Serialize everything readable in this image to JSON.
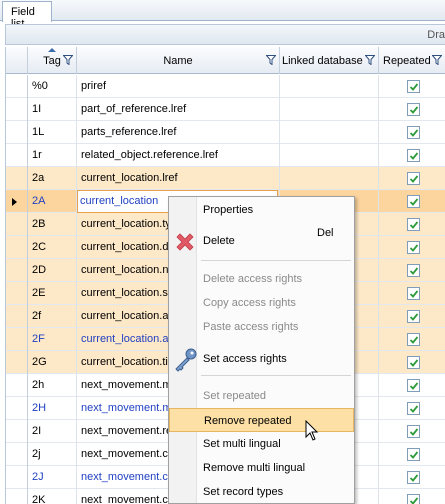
{
  "tab": {
    "label": "Field list"
  },
  "drag_area": {
    "text": "Dra"
  },
  "columns": [
    {
      "label": "Tag",
      "sorted": true,
      "filter": true
    },
    {
      "label": "Name",
      "filter": true
    },
    {
      "label": "Linked database",
      "filter": true
    },
    {
      "label": "Repeated",
      "filter": true
    }
  ],
  "rows": [
    {
      "tag": "%0",
      "name": "priref",
      "blue": false,
      "state": "normal",
      "repeated": true
    },
    {
      "tag": "1I",
      "name": "part_of_reference.lref",
      "blue": false,
      "state": "normal",
      "repeated": true
    },
    {
      "tag": "1L",
      "name": "parts_reference.lref",
      "blue": false,
      "state": "normal",
      "repeated": true
    },
    {
      "tag": "1r",
      "name": "related_object.reference.lref",
      "blue": false,
      "state": "normal",
      "repeated": true
    },
    {
      "tag": "2a",
      "name": "current_location.lref",
      "blue": false,
      "state": "alt",
      "repeated": true
    },
    {
      "tag": "2A",
      "name": "current_location",
      "blue": true,
      "state": "sel",
      "repeated": true
    },
    {
      "tag": "2B",
      "name": "current_location.ty",
      "blue": false,
      "state": "alt",
      "repeated": true
    },
    {
      "tag": "2C",
      "name": "current_location.da",
      "blue": false,
      "state": "alt",
      "repeated": true
    },
    {
      "tag": "2D",
      "name": "current_location.no",
      "blue": false,
      "state": "alt",
      "repeated": true
    },
    {
      "tag": "2E",
      "name": "current_location.su",
      "blue": false,
      "state": "alt",
      "repeated": true
    },
    {
      "tag": "2f",
      "name": "current_location.a",
      "blue": false,
      "state": "alt",
      "repeated": true
    },
    {
      "tag": "2F",
      "name": "current_location.a",
      "blue": true,
      "state": "alt",
      "repeated": true
    },
    {
      "tag": "2G",
      "name": "current_location.ti",
      "blue": false,
      "state": "alt",
      "repeated": true
    },
    {
      "tag": "2h",
      "name": "next_movement.m",
      "blue": false,
      "state": "normal",
      "repeated": true
    },
    {
      "tag": "2H",
      "name": "next_movement.m",
      "blue": true,
      "state": "normal",
      "repeated": true
    },
    {
      "tag": "2I",
      "name": "next_movement.re",
      "blue": false,
      "state": "normal",
      "repeated": true
    },
    {
      "tag": "2j",
      "name": "next_movement.co",
      "blue": false,
      "state": "normal",
      "repeated": true
    },
    {
      "tag": "2J",
      "name": "next_movement.co",
      "blue": true,
      "state": "normal",
      "repeated": true
    },
    {
      "tag": "2K",
      "name": "next_movement.co",
      "blue": false,
      "state": "normal",
      "repeated": true
    }
  ],
  "context_menu": {
    "items": [
      {
        "label": "Properties",
        "shortcut": "",
        "enabled": true,
        "icon": ""
      },
      {
        "label": "Delete",
        "shortcut": "Del",
        "enabled": true,
        "icon": "red-x-icon"
      },
      {
        "label": "Delete access rights",
        "shortcut": "",
        "enabled": false,
        "icon": ""
      },
      {
        "label": "Copy access rights",
        "shortcut": "",
        "enabled": false,
        "icon": ""
      },
      {
        "label": "Paste access rights",
        "shortcut": "",
        "enabled": false,
        "icon": ""
      },
      {
        "label": "Set access rights",
        "shortcut": "",
        "enabled": true,
        "icon": "key-icon"
      },
      {
        "label": "Set repeated",
        "shortcut": "",
        "enabled": false,
        "icon": ""
      },
      {
        "label": "Remove repeated",
        "shortcut": "",
        "enabled": true,
        "icon": "",
        "highlighted": true
      },
      {
        "label": "Set multi lingual",
        "shortcut": "",
        "enabled": true,
        "icon": ""
      },
      {
        "label": "Remove multi lingual",
        "shortcut": "",
        "enabled": true,
        "icon": ""
      },
      {
        "label": "Set record types",
        "shortcut": "",
        "enabled": true,
        "icon": ""
      }
    ]
  },
  "colors": {
    "selected_row": "#fbd49e",
    "alt_row": "#fde8c8",
    "blue_text": "#1f3fc2",
    "menu_highlight": "#fde0a6"
  }
}
